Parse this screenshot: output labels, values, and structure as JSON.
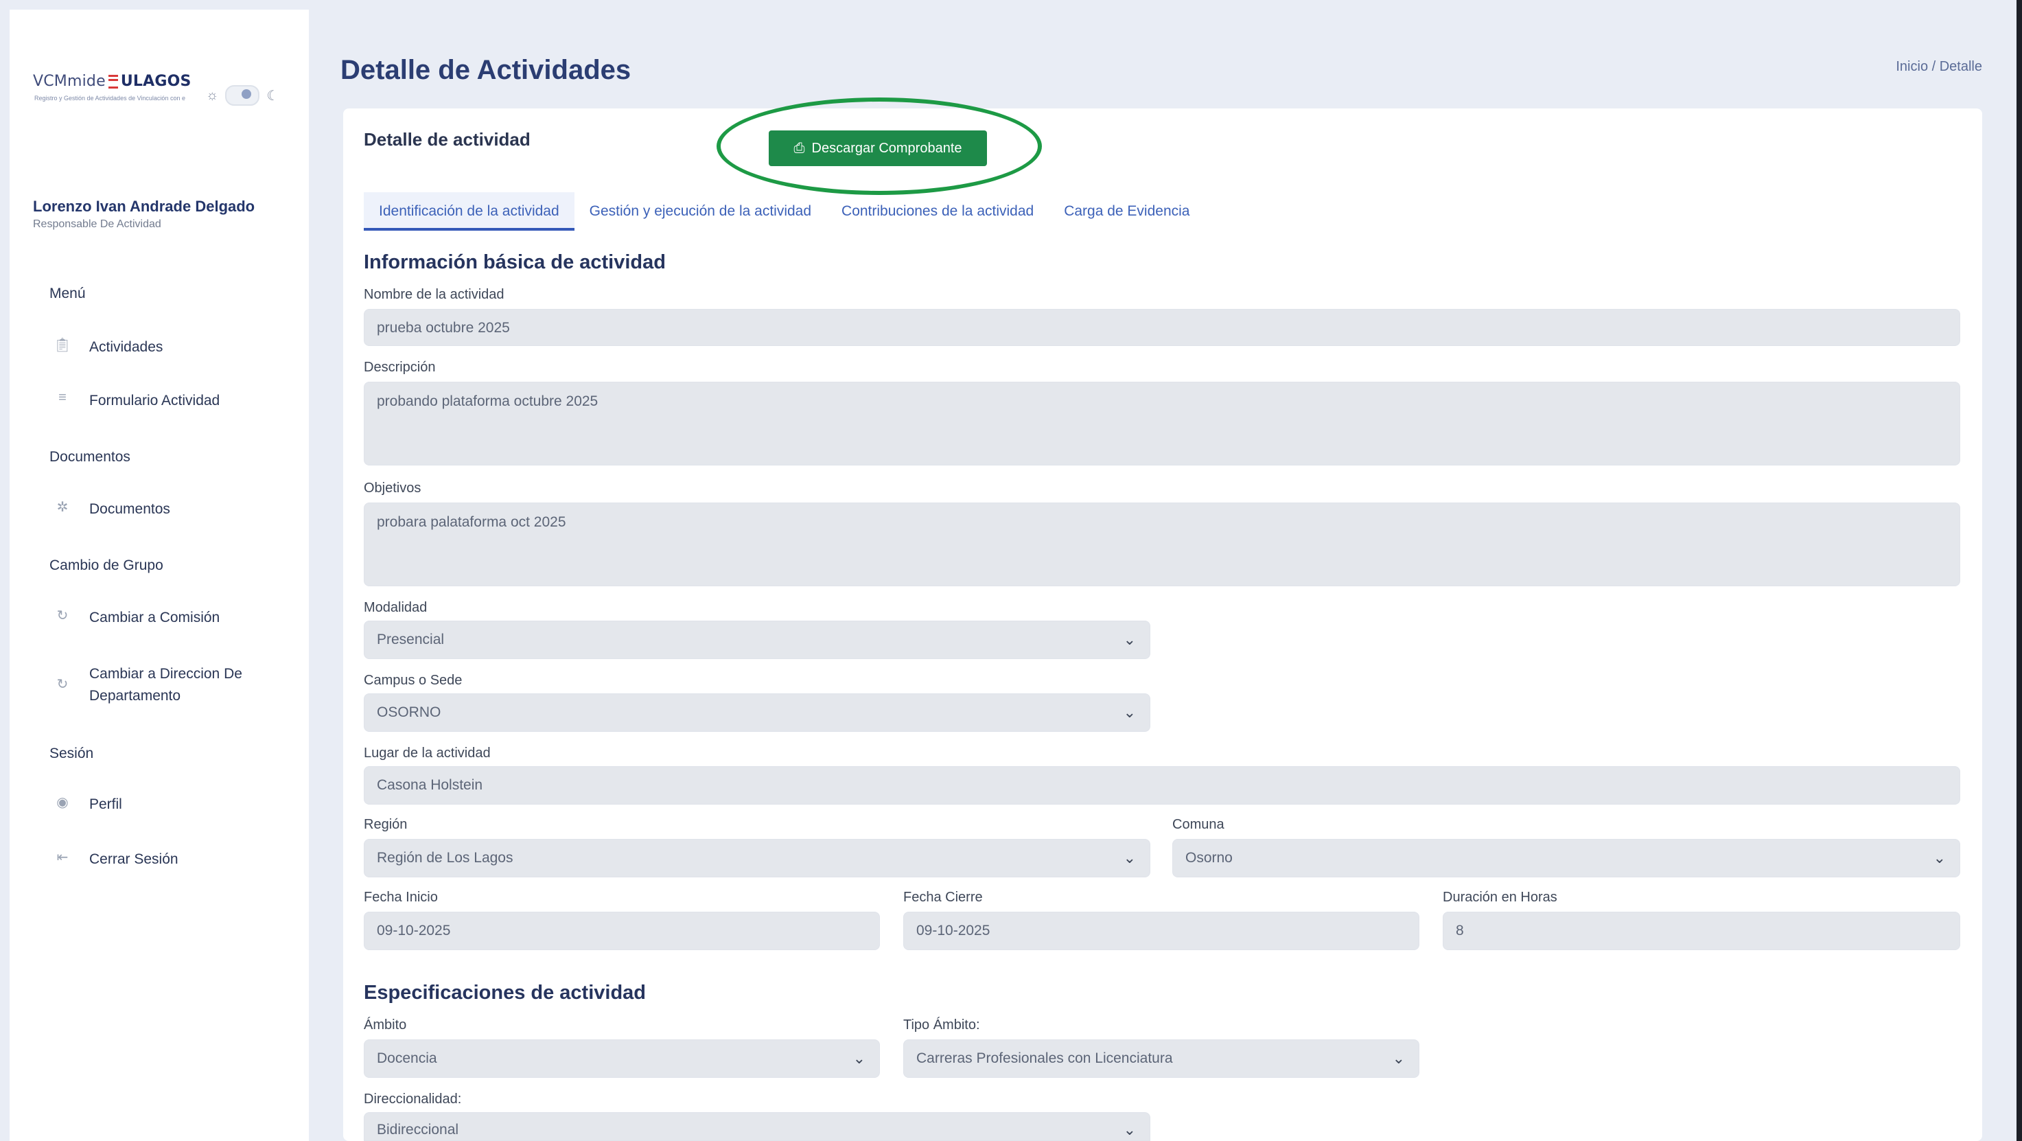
{
  "brand": {
    "logo_prefix": "VCMmide",
    "logo_name": "ULAGOS",
    "logo_tagline": "Registro y Gestión de Actividades de Vinculación con el Medio"
  },
  "user": {
    "name": "Lorenzo Ivan Andrade Delgado",
    "role": "Responsable De Actividad"
  },
  "sidebar": {
    "section_menu": "Menú",
    "item_actividades": "Actividades",
    "item_formulario": "Formulario Actividad",
    "section_documentos": "Documentos",
    "item_documentos": "Documentos",
    "section_grupo": "Cambio de Grupo",
    "item_comision": "Cambiar a Comisión",
    "item_direccion": "Cambiar a Direccion De Departamento",
    "section_sesion": "Sesión",
    "item_perfil": "Perfil",
    "item_logout": "Cerrar Sesión"
  },
  "header": {
    "title": "Detalle de Actividades",
    "breadcrumb": "Inicio / Detalle"
  },
  "card": {
    "title": "Detalle de actividad",
    "download_label": "Descargar Comprobante"
  },
  "tabs": [
    "Identificación de la actividad",
    "Gestión y ejecución de la actividad",
    "Contribuciones de la actividad",
    "Carga de Evidencia"
  ],
  "basic": {
    "heading": "Información básica de actividad",
    "nombre_label": "Nombre de la actividad",
    "nombre": "prueba octubre 2025",
    "descripcion_label": "Descripción",
    "descripcion": "probando plataforma octubre 2025",
    "objetivos_label": "Objetivos",
    "objetivos": "probara palataforma oct 2025",
    "modalidad_label": "Modalidad",
    "modalidad": "Presencial",
    "campus_label": "Campus o Sede",
    "campus": "OSORNO",
    "lugar_label": "Lugar de la actividad",
    "lugar": "Casona Holstein",
    "region_label": "Región",
    "region": "Región de Los Lagos",
    "comuna_label": "Comuna",
    "comuna": "Osorno",
    "inicio_label": "Fecha Inicio",
    "inicio": "09-10-2025",
    "cierre_label": "Fecha Cierre",
    "cierre": "09-10-2025",
    "duracion_label": "Duración en Horas",
    "duracion": "8"
  },
  "specs": {
    "heading": "Especificaciones de actividad",
    "ambito_label": "Ámbito",
    "ambito": "Docencia",
    "tipo_label": "Tipo Ámbito:",
    "tipo": "Carreras Profesionales con Licenciatura",
    "direccionalidad_label": "Direccionalidad:",
    "direccionalidad": "Bidireccional"
  },
  "icons": {
    "sun": "sun-icon",
    "moon": "moon-icon",
    "actividades": "clipboard-icon",
    "formulario": "list-icon",
    "documentos": "dots-circle-icon",
    "comision": "refresh-icon",
    "direccion": "refresh-icon",
    "perfil": "user-circle-icon",
    "logout": "logout-icon",
    "download": "file-download-icon",
    "select": "chevron-down-icon"
  },
  "colors": {
    "accent": "#3458b8",
    "download_button": "#1e8a4a",
    "highlight_ellipse": "#1d9a45",
    "field_bg": "#e4e7ec"
  }
}
